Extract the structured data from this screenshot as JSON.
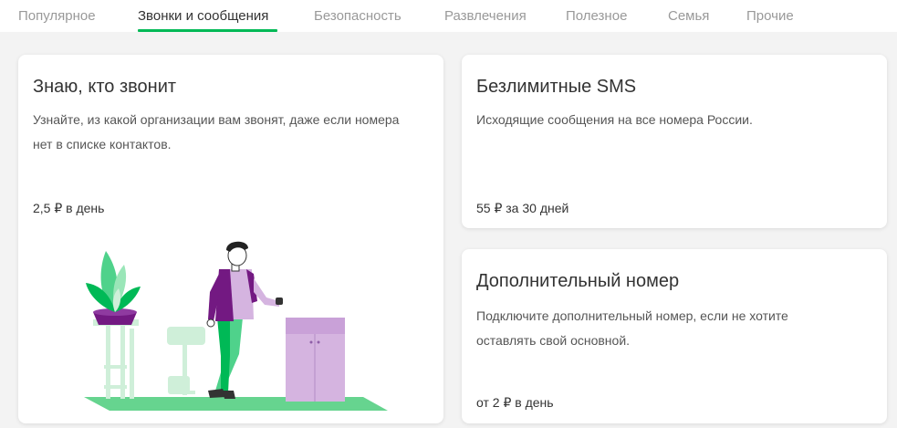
{
  "tabs": [
    {
      "label": "Популярное",
      "active": false
    },
    {
      "label": "Звонки и сообщения",
      "active": true
    },
    {
      "label": "Безопасность",
      "active": false
    },
    {
      "label": "Развлечения",
      "active": false
    },
    {
      "label": "Полезное",
      "active": false
    },
    {
      "label": "Семья",
      "active": false
    },
    {
      "label": "Прочие",
      "active": false
    }
  ],
  "colors": {
    "accent": "#00b956",
    "purple": "#731982",
    "light_green": "#cfefd9",
    "lilac": "#d5b4e0"
  },
  "cards": {
    "know_caller": {
      "title": "Знаю, кто звонит",
      "description": "Узнайте, из какой организации вам звонят, даже если номера нет в списке контактов.",
      "price": "2,5 ₽ в день"
    },
    "unlimited_sms": {
      "title": "Безлимитные SMS",
      "description": "Исходящие сообщения на все номера России.",
      "price": "55 ₽ за 30 дней"
    },
    "extra_number": {
      "title": "Дополнительный номер",
      "description": "Подключите дополнительный номер, если не хотите оставлять свой основной.",
      "price": "от 2 ₽ в день"
    }
  }
}
